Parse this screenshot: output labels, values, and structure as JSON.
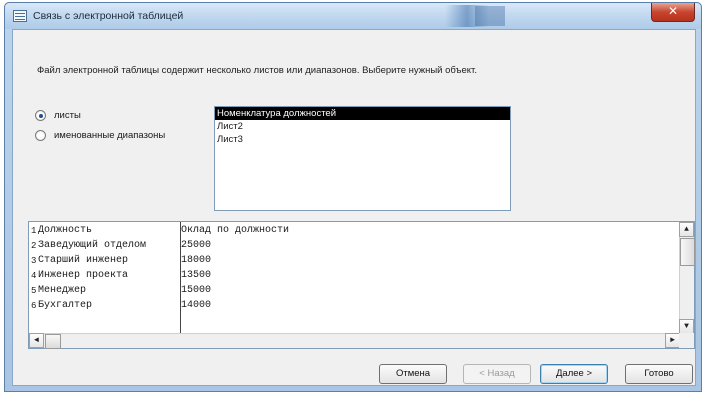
{
  "window": {
    "title": "Связь с электронной таблицей",
    "close_glyph": "✕"
  },
  "prompt": "Файл электронной таблицы содержит несколько листов или диапазонов. Выберите нужный объект.",
  "options": {
    "sheets": {
      "label": "листы",
      "checked": true
    },
    "ranges": {
      "label": "именованные диапазоны",
      "checked": false
    }
  },
  "sheet_list": {
    "items": [
      "Номенклатура должностей",
      "Лист2",
      "Лист3"
    ],
    "selected_index": 0
  },
  "preview": {
    "rows": [
      {
        "num": "1",
        "col1": "Должность",
        "col2": "Оклад по должности"
      },
      {
        "num": "2",
        "col1": "Заведующий отделом",
        "col2": "25000"
      },
      {
        "num": "3",
        "col1": "Старший инженер",
        "col2": "18000"
      },
      {
        "num": "4",
        "col1": "Инженер проекта",
        "col2": "13500"
      },
      {
        "num": "5",
        "col1": "Менеджер",
        "col2": "15000"
      },
      {
        "num": "6",
        "col1": "Бухгалтер",
        "col2": "14000"
      }
    ],
    "scroll_up": "▲",
    "scroll_down": "▼",
    "scroll_left": "◄",
    "scroll_right": "►"
  },
  "buttons": {
    "cancel": "Отмена",
    "back": "< Назад",
    "next": "Далее >",
    "finish": "Готово"
  }
}
